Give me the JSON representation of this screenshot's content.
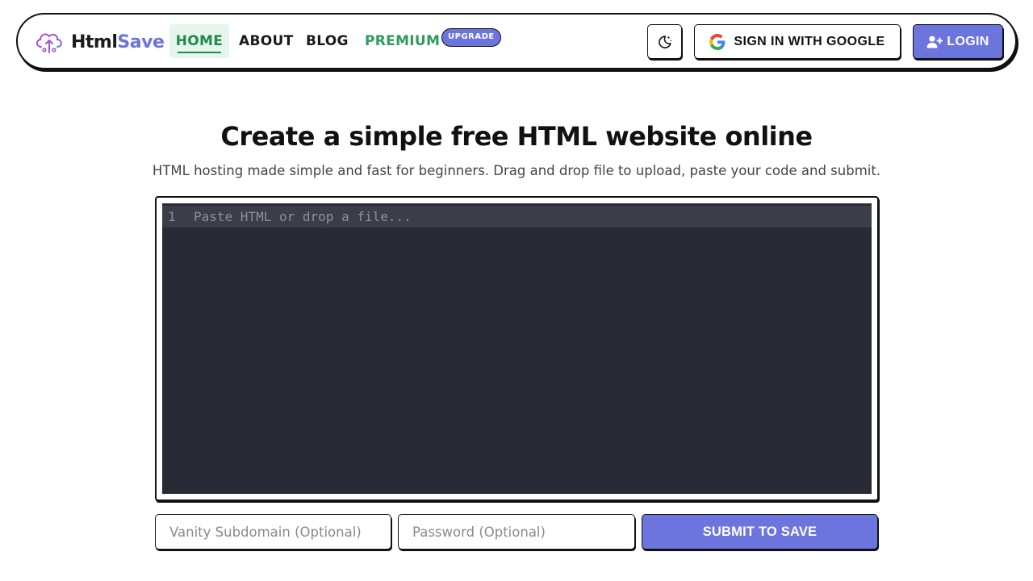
{
  "brand": {
    "part1": "Html",
    "part2": "Save",
    "colors": {
      "primary": "#6c74dd",
      "green": "#1f8a4c",
      "premium": "#2e9b5d"
    }
  },
  "nav": {
    "items": [
      {
        "label": "HOME",
        "active": true
      },
      {
        "label": "ABOUT"
      },
      {
        "label": "BLOG"
      },
      {
        "label": "PREMIUM"
      }
    ],
    "badge": "UPGRADE"
  },
  "actions": {
    "theme_icon": "moon-stars-icon",
    "google_label": "SIGN IN WITH GOOGLE",
    "login_label": "LOGIN"
  },
  "hero": {
    "title": "Create a simple free HTML website online",
    "subtitle": "HTML hosting made simple and fast for beginners. Drag and drop file to upload, paste your code and submit."
  },
  "editor": {
    "line_number": "1",
    "placeholder": "Paste HTML or drop a file..."
  },
  "form": {
    "subdomain_placeholder": "Vanity Subdomain (Optional)",
    "password_placeholder": "Password (Optional)",
    "submit_label": "SUBMIT TO SAVE"
  }
}
